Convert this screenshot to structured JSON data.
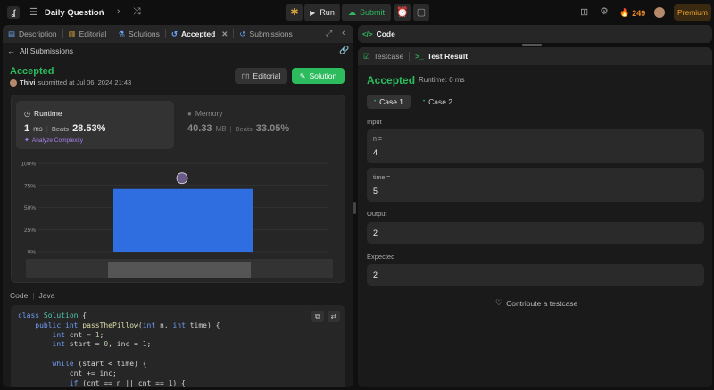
{
  "topbar": {
    "title": "Daily Question",
    "run_label": "Run",
    "submit_label": "Submit",
    "streak": "249",
    "premium_label": "Premium"
  },
  "left_tabs": {
    "description": "Description",
    "editorial": "Editorial",
    "solutions": "Solutions",
    "accepted": "Accepted",
    "submissions": "Submissions"
  },
  "submission": {
    "back_label": "All Submissions",
    "status": "Accepted",
    "user": "Thivi",
    "submitted_text": "submitted at Jul 06, 2024 21:43",
    "editorial_btn": "Editorial",
    "solution_btn": "Solution"
  },
  "runtime": {
    "label": "Runtime",
    "value": "1",
    "unit": "ms",
    "beats_label": "Beats",
    "beats_value": "28.53%",
    "analyze_label": "Analyze Complexity"
  },
  "memory": {
    "label": "Memory",
    "value": "40.33",
    "unit": "MB",
    "beats_label": "Beats",
    "beats_value": "33.05%"
  },
  "chart_data": {
    "type": "bar",
    "ytick_labels": [
      "100%",
      "75%",
      "50%",
      "25%",
      "0%"
    ],
    "ylim": [
      0,
      100
    ],
    "values": [
      71
    ],
    "colors": {
      "bar": "#2f6ee0"
    }
  },
  "code": {
    "label": "Code",
    "language": "Java",
    "lines": [
      "class Solution {",
      "    public int passThePillow(int n, int time) {",
      "        int cnt = 1;",
      "        int start = 0, inc = 1;",
      "",
      "        while (start < time) {",
      "            cnt += inc;",
      "            if (cnt == n || cnt == 1) {"
    ]
  },
  "right": {
    "code_tab": "Code",
    "testcase_tab": "Testcase",
    "result_tab": "Test Result",
    "status": "Accepted",
    "runtime_text": "Runtime: 0 ms",
    "case1": "Case 1",
    "case2": "Case 2",
    "input_label": "Input",
    "param1_name": "n =",
    "param1_value": "4",
    "param2_name": "time =",
    "param2_value": "5",
    "output_label": "Output",
    "output_value": "2",
    "expected_label": "Expected",
    "expected_value": "2",
    "contribute_label": "Contribute a testcase"
  }
}
